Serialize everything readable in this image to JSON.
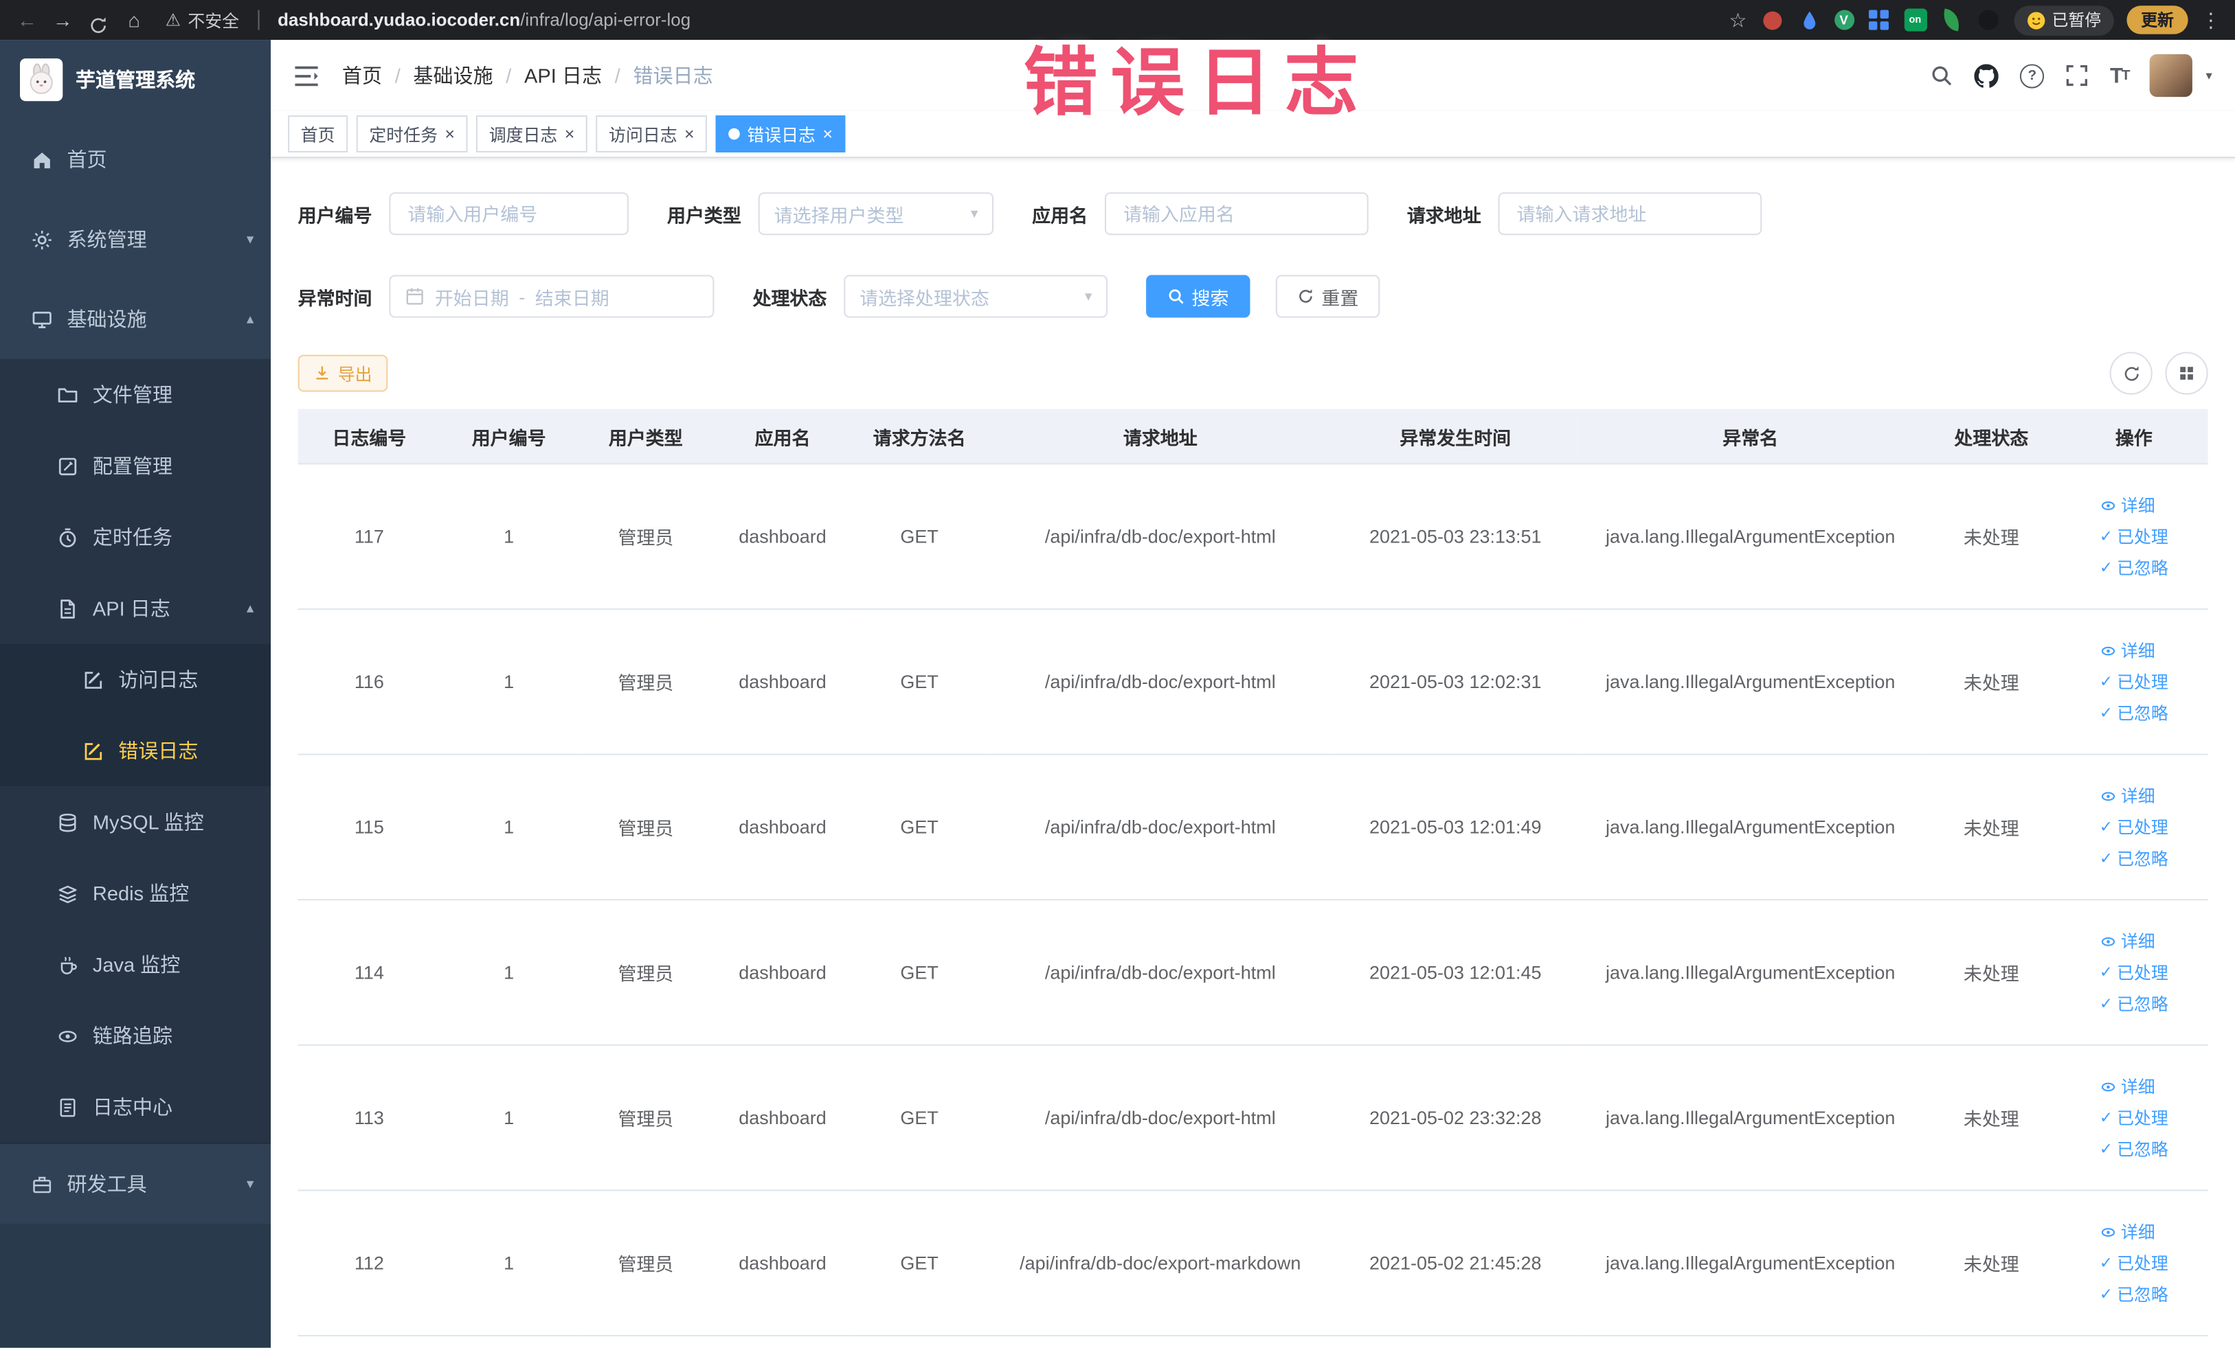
{
  "browser": {
    "security_label": "不安全",
    "url_domain": "dashboard.yudao.iocoder.cn",
    "url_path": "/infra/log/api-error-log",
    "profile_badge": "已暂停",
    "update_button": "更新",
    "ext_on_label": "on",
    "ext_vue_label": "V"
  },
  "overlay": {
    "text": "错误日志"
  },
  "icons": {
    "back": "←",
    "forward": "→",
    "home": "⌂",
    "warning": "⚠",
    "star": "☆",
    "more": "⋮",
    "close": "×",
    "arrow_down": "▾",
    "arrow_up": "▴",
    "caret_down": "▾",
    "check": "✓",
    "question": "?",
    "slash": "/"
  },
  "sidebar": {
    "logo_title": "芋道管理系统",
    "items": [
      {
        "label": "首页"
      },
      {
        "label": "系统管理"
      },
      {
        "label": "基础设施"
      },
      {
        "label": "文件管理"
      },
      {
        "label": "配置管理"
      },
      {
        "label": "定时任务"
      },
      {
        "label": "API 日志"
      },
      {
        "label": "访问日志"
      },
      {
        "label": "错误日志"
      },
      {
        "label": "MySQL 监控"
      },
      {
        "label": "Redis 监控"
      },
      {
        "label": "Java 监控"
      },
      {
        "label": "链路追踪"
      },
      {
        "label": "日志中心"
      },
      {
        "label": "研发工具"
      }
    ]
  },
  "header": {
    "breadcrumb": [
      {
        "label": "首页"
      },
      {
        "label": "基础设施"
      },
      {
        "label": "API 日志"
      },
      {
        "label": "错误日志"
      }
    ]
  },
  "tabs": [
    {
      "label": "首页"
    },
    {
      "label": "定时任务"
    },
    {
      "label": "调度日志"
    },
    {
      "label": "访问日志"
    },
    {
      "label": "错误日志"
    }
  ],
  "filters": {
    "user_id": {
      "label": "用户编号",
      "placeholder": "请输入用户编号"
    },
    "user_type": {
      "label": "用户类型",
      "placeholder": "请选择用户类型"
    },
    "app_name": {
      "label": "应用名",
      "placeholder": "请输入应用名"
    },
    "request_url": {
      "label": "请求地址",
      "placeholder": "请输入请求地址"
    },
    "exception_time": {
      "label": "异常时间",
      "start_placeholder": "开始日期",
      "separator": "-",
      "end_placeholder": "结束日期"
    },
    "process_status": {
      "label": "处理状态",
      "placeholder": "请选择处理状态"
    },
    "search_button": "搜索",
    "reset_button": "重置"
  },
  "toolbar": {
    "export_button": "导出"
  },
  "table": {
    "columns": [
      "日志编号",
      "用户编号",
      "用户类型",
      "应用名",
      "请求方法名",
      "请求地址",
      "异常发生时间",
      "异常名",
      "处理状态",
      "操作"
    ],
    "actions": {
      "detail": "详细",
      "processed": "已处理",
      "ignored": "已忽略"
    },
    "rows": [
      {
        "id": "117",
        "user_id": "1",
        "user_type": "管理员",
        "app_name": "dashboard",
        "method": "GET",
        "url": "/api/infra/db-doc/export-html",
        "time": "2021-05-03 23:13:51",
        "exception": "java.lang.IllegalArgumentException",
        "status": "未处理"
      },
      {
        "id": "116",
        "user_id": "1",
        "user_type": "管理员",
        "app_name": "dashboard",
        "method": "GET",
        "url": "/api/infra/db-doc/export-html",
        "time": "2021-05-03 12:02:31",
        "exception": "java.lang.IllegalArgumentException",
        "status": "未处理"
      },
      {
        "id": "115",
        "user_id": "1",
        "user_type": "管理员",
        "app_name": "dashboard",
        "method": "GET",
        "url": "/api/infra/db-doc/export-html",
        "time": "2021-05-03 12:01:49",
        "exception": "java.lang.IllegalArgumentException",
        "status": "未处理"
      },
      {
        "id": "114",
        "user_id": "1",
        "user_type": "管理员",
        "app_name": "dashboard",
        "method": "GET",
        "url": "/api/infra/db-doc/export-html",
        "time": "2021-05-03 12:01:45",
        "exception": "java.lang.IllegalArgumentException",
        "status": "未处理"
      },
      {
        "id": "113",
        "user_id": "1",
        "user_type": "管理员",
        "app_name": "dashboard",
        "method": "GET",
        "url": "/api/infra/db-doc/export-html",
        "time": "2021-05-02 23:32:28",
        "exception": "java.lang.IllegalArgumentException",
        "status": "未处理"
      },
      {
        "id": "112",
        "user_id": "1",
        "user_type": "管理员",
        "app_name": "dashboard",
        "method": "GET",
        "url": "/api/infra/db-doc/export-markdown",
        "time": "2021-05-02 21:45:28",
        "exception": "java.lang.IllegalArgumentException",
        "status": "未处理"
      }
    ]
  }
}
